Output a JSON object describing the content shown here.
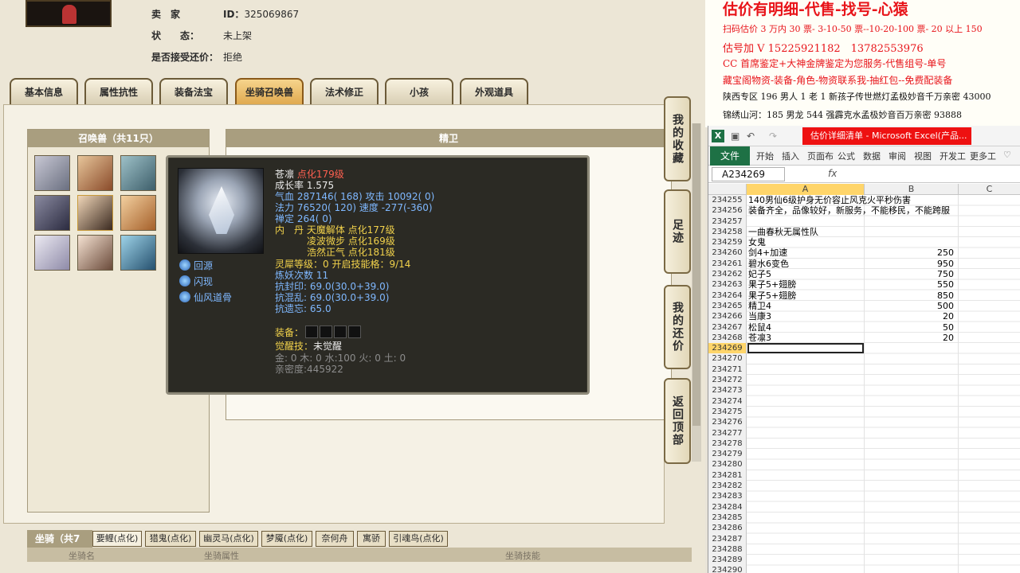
{
  "seller": {
    "label_seller": "卖　家",
    "id_label": "ID：",
    "id_value": "325069867",
    "label_status": "状　　态：",
    "status_value": "未上架",
    "label_bargain": "是否接受还价：",
    "bargain_value": "拒绝"
  },
  "tabs": [
    "基本信息",
    "属性抗性",
    "装备法宝",
    "坐骑召唤兽",
    "法术修正",
    "小孩",
    "外观道具"
  ],
  "active_tab": 3,
  "pet_list": {
    "title": "召唤兽（共11只）"
  },
  "detail": {
    "title": "精卫"
  },
  "tooltip": {
    "name": "苍凛",
    "name_suffix": "点化179级",
    "growth": "成长率 1.575",
    "hp_line": "气血 287146( 168)",
    "atk_line": "攻击 10092( 0)",
    "mp_line": "法力 76520( 120)",
    "speed_line": "速度 -277(-360)",
    "zen_line": "禅定 264( 0)",
    "neidan_label": "内　丹",
    "neidan": [
      "天魔解体 点化177级",
      "凌波微步 点化169级",
      "浩然正气 点化181级"
    ],
    "skills": [
      "回源",
      "闪现",
      "仙风道骨"
    ],
    "lingxi": "灵犀等级：0 开启技能格：9/14",
    "lianyao": "炼妖次数 11",
    "kangfeng": "抗封印: 69.0(30.0+39.0)",
    "kanghun": "抗混乱: 69.0(30.0+39.0)",
    "kangyi": "抗遗忘: 65.0",
    "equip_label": "装备：",
    "awaken_label": "觉醒技：",
    "awaken_value": "未觉醒",
    "elements": "金: 0 木: 0 水:100 火: 0 土: 0",
    "intimacy": "亲密度:445922"
  },
  "side_buttons": [
    "我的收藏",
    "足迹",
    "我的还价",
    "返回顶部"
  ],
  "mounts": {
    "label": "坐骑（共7只）",
    "tabs": [
      "要鲤(点化)",
      "猎鬼(点化)",
      "幽灵马(点化)",
      "梦魇(点化)",
      "奈何舟",
      "寓骄",
      "引魂鸟(点化)"
    ],
    "col_name": "坐骑名",
    "col_attr": "坐骑属性",
    "col_skill": "坐骑技能"
  },
  "promo": {
    "title": "估价有明细-代售-找号-心猿",
    "line1": "扫码估价 3 万内 30 票- 3-10-50 票--10-20-100 票- 20 以上 150",
    "line2": "估号加 V 15225921182　13782553976",
    "line3": "CC 首席鉴定+大神金牌鉴定为您服务-代售组号-单号",
    "line4": "藏宝阁物资-装备-角色-物资联系我-抽红包--免费配装备",
    "line5": "陕西专区 196 男人 1 老 1 新孩子传世燃灯孟极妙音千万亲密 43000",
    "line6": "锦绣山河：185 男龙 544 强霹克水孟极妙音百万亲密 93888"
  },
  "excel": {
    "doc_title": "估价详细清单 - Microsoft Excel(产品...",
    "file_tab": "文件",
    "ribbon": [
      "开始",
      "插入",
      "页面布",
      "公式",
      "数据",
      "审阅",
      "视图",
      "开发工",
      "更多工"
    ],
    "name_box": "A234269",
    "fx": "fx",
    "columns": [
      "A",
      "B",
      "C"
    ],
    "rows": [
      {
        "n": "234255",
        "a": "140男仙6级护身无价容止风克火平秒伤害",
        "b": ""
      },
      {
        "n": "234256",
        "a": "装备齐全，品像较好，新服务，不能移民，不能跨服",
        "b": ""
      },
      {
        "n": "234257",
        "a": "",
        "b": ""
      },
      {
        "n": "234258",
        "a": "一曲春秋无属性队",
        "b": ""
      },
      {
        "n": "234259",
        "a": "女鬼",
        "b": ""
      },
      {
        "n": "234260",
        "a": "剑4+加速",
        "b": "250"
      },
      {
        "n": "234261",
        "a": "碧水6变色",
        "b": "950"
      },
      {
        "n": "234262",
        "a": "妃子5",
        "b": "750"
      },
      {
        "n": "234263",
        "a": "果子5+翅膀",
        "b": "550"
      },
      {
        "n": "234264",
        "a": "果子5+翅膀",
        "b": "850"
      },
      {
        "n": "234265",
        "a": "精卫4",
        "b": "500"
      },
      {
        "n": "234266",
        "a": "当康3",
        "b": "20"
      },
      {
        "n": "234267",
        "a": "松鼠4",
        "b": "50"
      },
      {
        "n": "234268",
        "a": "苍凛3",
        "b": "20"
      },
      {
        "n": "234269",
        "a": "",
        "b": ""
      },
      {
        "n": "234270",
        "a": "",
        "b": ""
      },
      {
        "n": "234271",
        "a": "",
        "b": ""
      },
      {
        "n": "234272",
        "a": "",
        "b": ""
      },
      {
        "n": "234273",
        "a": "",
        "b": ""
      },
      {
        "n": "234274",
        "a": "",
        "b": ""
      },
      {
        "n": "234275",
        "a": "",
        "b": ""
      },
      {
        "n": "234276",
        "a": "",
        "b": ""
      },
      {
        "n": "234277",
        "a": "",
        "b": ""
      },
      {
        "n": "234278",
        "a": "",
        "b": ""
      },
      {
        "n": "234279",
        "a": "",
        "b": ""
      },
      {
        "n": "234280",
        "a": "",
        "b": ""
      },
      {
        "n": "234281",
        "a": "",
        "b": ""
      },
      {
        "n": "234282",
        "a": "",
        "b": ""
      },
      {
        "n": "234283",
        "a": "",
        "b": ""
      },
      {
        "n": "234284",
        "a": "",
        "b": ""
      },
      {
        "n": "234285",
        "a": "",
        "b": ""
      },
      {
        "n": "234286",
        "a": "",
        "b": ""
      },
      {
        "n": "234287",
        "a": "",
        "b": ""
      },
      {
        "n": "234288",
        "a": "",
        "b": ""
      },
      {
        "n": "234289",
        "a": "",
        "b": ""
      },
      {
        "n": "234290",
        "a": "",
        "b": ""
      }
    ],
    "selected_row": "234269"
  }
}
